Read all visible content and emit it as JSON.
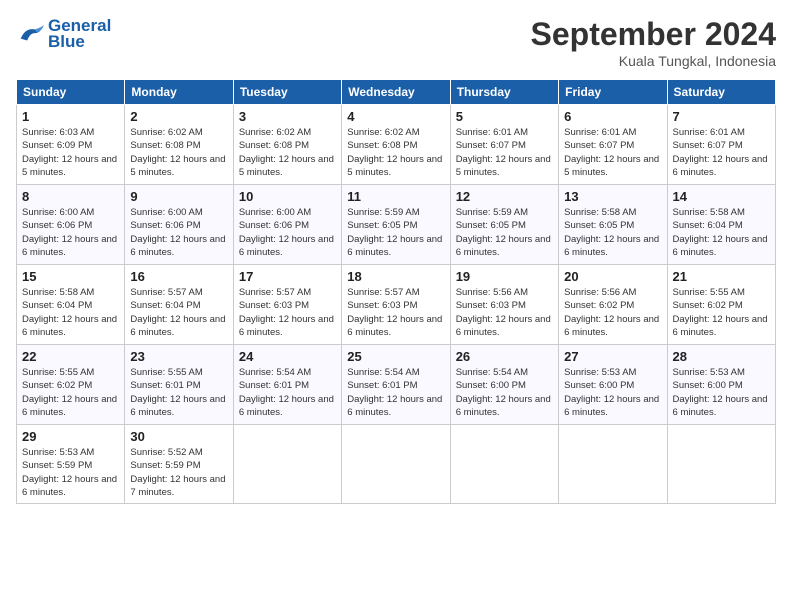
{
  "logo": {
    "line1": "General",
    "line2": "Blue"
  },
  "title": "September 2024",
  "subtitle": "Kuala Tungkal, Indonesia",
  "days_of_week": [
    "Sunday",
    "Monday",
    "Tuesday",
    "Wednesday",
    "Thursday",
    "Friday",
    "Saturday"
  ],
  "weeks": [
    [
      {
        "day": "1",
        "sunrise": "6:03 AM",
        "sunset": "6:09 PM",
        "daylight": "12 hours and 5 minutes."
      },
      {
        "day": "2",
        "sunrise": "6:02 AM",
        "sunset": "6:08 PM",
        "daylight": "12 hours and 5 minutes."
      },
      {
        "day": "3",
        "sunrise": "6:02 AM",
        "sunset": "6:08 PM",
        "daylight": "12 hours and 5 minutes."
      },
      {
        "day": "4",
        "sunrise": "6:02 AM",
        "sunset": "6:08 PM",
        "daylight": "12 hours and 5 minutes."
      },
      {
        "day": "5",
        "sunrise": "6:01 AM",
        "sunset": "6:07 PM",
        "daylight": "12 hours and 5 minutes."
      },
      {
        "day": "6",
        "sunrise": "6:01 AM",
        "sunset": "6:07 PM",
        "daylight": "12 hours and 5 minutes."
      },
      {
        "day": "7",
        "sunrise": "6:01 AM",
        "sunset": "6:07 PM",
        "daylight": "12 hours and 6 minutes."
      }
    ],
    [
      {
        "day": "8",
        "sunrise": "6:00 AM",
        "sunset": "6:06 PM",
        "daylight": "12 hours and 6 minutes."
      },
      {
        "day": "9",
        "sunrise": "6:00 AM",
        "sunset": "6:06 PM",
        "daylight": "12 hours and 6 minutes."
      },
      {
        "day": "10",
        "sunrise": "6:00 AM",
        "sunset": "6:06 PM",
        "daylight": "12 hours and 6 minutes."
      },
      {
        "day": "11",
        "sunrise": "5:59 AM",
        "sunset": "6:05 PM",
        "daylight": "12 hours and 6 minutes."
      },
      {
        "day": "12",
        "sunrise": "5:59 AM",
        "sunset": "6:05 PM",
        "daylight": "12 hours and 6 minutes."
      },
      {
        "day": "13",
        "sunrise": "5:58 AM",
        "sunset": "6:05 PM",
        "daylight": "12 hours and 6 minutes."
      },
      {
        "day": "14",
        "sunrise": "5:58 AM",
        "sunset": "6:04 PM",
        "daylight": "12 hours and 6 minutes."
      }
    ],
    [
      {
        "day": "15",
        "sunrise": "5:58 AM",
        "sunset": "6:04 PM",
        "daylight": "12 hours and 6 minutes."
      },
      {
        "day": "16",
        "sunrise": "5:57 AM",
        "sunset": "6:04 PM",
        "daylight": "12 hours and 6 minutes."
      },
      {
        "day": "17",
        "sunrise": "5:57 AM",
        "sunset": "6:03 PM",
        "daylight": "12 hours and 6 minutes."
      },
      {
        "day": "18",
        "sunrise": "5:57 AM",
        "sunset": "6:03 PM",
        "daylight": "12 hours and 6 minutes."
      },
      {
        "day": "19",
        "sunrise": "5:56 AM",
        "sunset": "6:03 PM",
        "daylight": "12 hours and 6 minutes."
      },
      {
        "day": "20",
        "sunrise": "5:56 AM",
        "sunset": "6:02 PM",
        "daylight": "12 hours and 6 minutes."
      },
      {
        "day": "21",
        "sunrise": "5:55 AM",
        "sunset": "6:02 PM",
        "daylight": "12 hours and 6 minutes."
      }
    ],
    [
      {
        "day": "22",
        "sunrise": "5:55 AM",
        "sunset": "6:02 PM",
        "daylight": "12 hours and 6 minutes."
      },
      {
        "day": "23",
        "sunrise": "5:55 AM",
        "sunset": "6:01 PM",
        "daylight": "12 hours and 6 minutes."
      },
      {
        "day": "24",
        "sunrise": "5:54 AM",
        "sunset": "6:01 PM",
        "daylight": "12 hours and 6 minutes."
      },
      {
        "day": "25",
        "sunrise": "5:54 AM",
        "sunset": "6:01 PM",
        "daylight": "12 hours and 6 minutes."
      },
      {
        "day": "26",
        "sunrise": "5:54 AM",
        "sunset": "6:00 PM",
        "daylight": "12 hours and 6 minutes."
      },
      {
        "day": "27",
        "sunrise": "5:53 AM",
        "sunset": "6:00 PM",
        "daylight": "12 hours and 6 minutes."
      },
      {
        "day": "28",
        "sunrise": "5:53 AM",
        "sunset": "6:00 PM",
        "daylight": "12 hours and 6 minutes."
      }
    ],
    [
      {
        "day": "29",
        "sunrise": "5:53 AM",
        "sunset": "5:59 PM",
        "daylight": "12 hours and 6 minutes."
      },
      {
        "day": "30",
        "sunrise": "5:52 AM",
        "sunset": "5:59 PM",
        "daylight": "12 hours and 7 minutes."
      },
      null,
      null,
      null,
      null,
      null
    ]
  ]
}
